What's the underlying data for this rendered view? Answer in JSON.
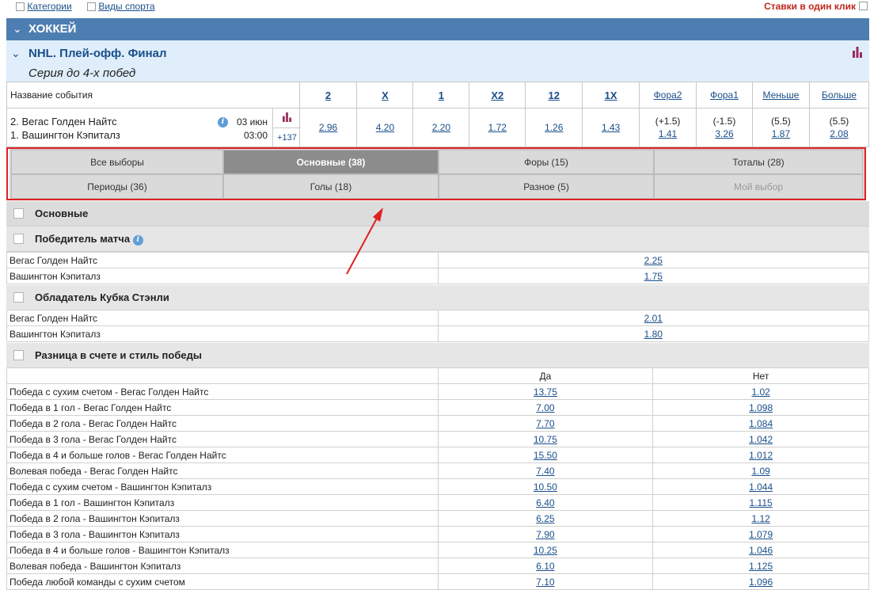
{
  "topbar": {
    "categories": "Категории",
    "sports": "Виды спорта",
    "one_click": "Ставки в один клик"
  },
  "sport": {
    "name": "ХОККЕЙ"
  },
  "league": {
    "title": "NHL. Плей-офф. Финал",
    "subtitle": "Серия до 4-х побед"
  },
  "market_header": {
    "event_name": "Название события",
    "cols": [
      "2",
      "X",
      "1",
      "X2",
      "12",
      "1X",
      "Фора2",
      "Фора1",
      "Меньше",
      "Больше"
    ]
  },
  "event": {
    "team2": "2. Вегас Голден Найтс",
    "team1": "1. Вашингтон Кэпиталз",
    "date": "03 июн",
    "time": "03:00",
    "more": "+137",
    "odds": [
      "2.96",
      "4.20",
      "2.20",
      "1.72",
      "1.26",
      "1.43"
    ],
    "fora2_line": "(+1.5)",
    "fora2_odd": "1.41",
    "fora1_line": "(-1.5)",
    "fora1_odd": "3.26",
    "under_line": "(5.5)",
    "under_odd": "1.87",
    "over_line": "(5.5)",
    "over_odd": "2.08"
  },
  "tabs": {
    "all": "Все выборы",
    "main": "Основные (38)",
    "foras": "Форы (15)",
    "totals": "Тоталы (28)",
    "periods": "Периоды (36)",
    "goals": "Голы (18)",
    "misc": "Разное (5)",
    "my": "Мой выбор"
  },
  "sections": {
    "main": "Основные",
    "winner": "Победитель матча",
    "cup": "Обладатель Кубка Стэнли",
    "diff": "Разница в счете и стиль победы"
  },
  "winner_rows": [
    {
      "name": "Вегас Голден Найтс",
      "odd": "2.25"
    },
    {
      "name": "Вашингтон Кэпиталз",
      "odd": "1.75"
    }
  ],
  "cup_rows": [
    {
      "name": "Вегас Голден Найтс",
      "odd": "2.01"
    },
    {
      "name": "Вашингтон Кэпиталз",
      "odd": "1.80"
    }
  ],
  "diff_header": {
    "yes": "Да",
    "no": "Нет"
  },
  "diff_rows": [
    {
      "name": "Победа с сухим счетом - Вегас Голден Найтс",
      "yes": "13.75",
      "no": "1.02"
    },
    {
      "name": "Победа в 1 гол - Вегас Голден Найтс",
      "yes": "7.00",
      "no": "1.098"
    },
    {
      "name": "Победа в 2 гола - Вегас Голден Найтс",
      "yes": "7.70",
      "no": "1.084"
    },
    {
      "name": "Победа в 3 гола - Вегас Голден Найтс",
      "yes": "10.75",
      "no": "1.042"
    },
    {
      "name": "Победа в 4 и больше голов - Вегас Голден Найтс",
      "yes": "15.50",
      "no": "1.012"
    },
    {
      "name": "Волевая победа - Вегас Голден Найтс",
      "yes": "7.40",
      "no": "1.09"
    },
    {
      "name": "Победа с сухим счетом - Вашингтон Кэпиталз",
      "yes": "10.50",
      "no": "1.044"
    },
    {
      "name": "Победа в 1 гол - Вашингтон Кэпиталз",
      "yes": "6.40",
      "no": "1.115"
    },
    {
      "name": "Победа в 2 гола - Вашингтон Кэпиталз",
      "yes": "6.25",
      "no": "1.12"
    },
    {
      "name": "Победа в 3 гола - Вашингтон Кэпиталз",
      "yes": "7.90",
      "no": "1.079"
    },
    {
      "name": "Победа в 4 и больше голов - Вашингтон Кэпиталз",
      "yes": "10.25",
      "no": "1.046"
    },
    {
      "name": "Волевая победа - Вашингтон Кэпиталз",
      "yes": "6.10",
      "no": "1.125"
    },
    {
      "name": "Победа любой команды с сухим счетом",
      "yes": "7.10",
      "no": "1.096"
    }
  ],
  "colors": {
    "sport_bar": "#4d7eb1",
    "league_bg": "#dfeefa",
    "link": "#1a4f8a",
    "highlight": "#e02020",
    "active_tab": "#8c8c8c"
  }
}
